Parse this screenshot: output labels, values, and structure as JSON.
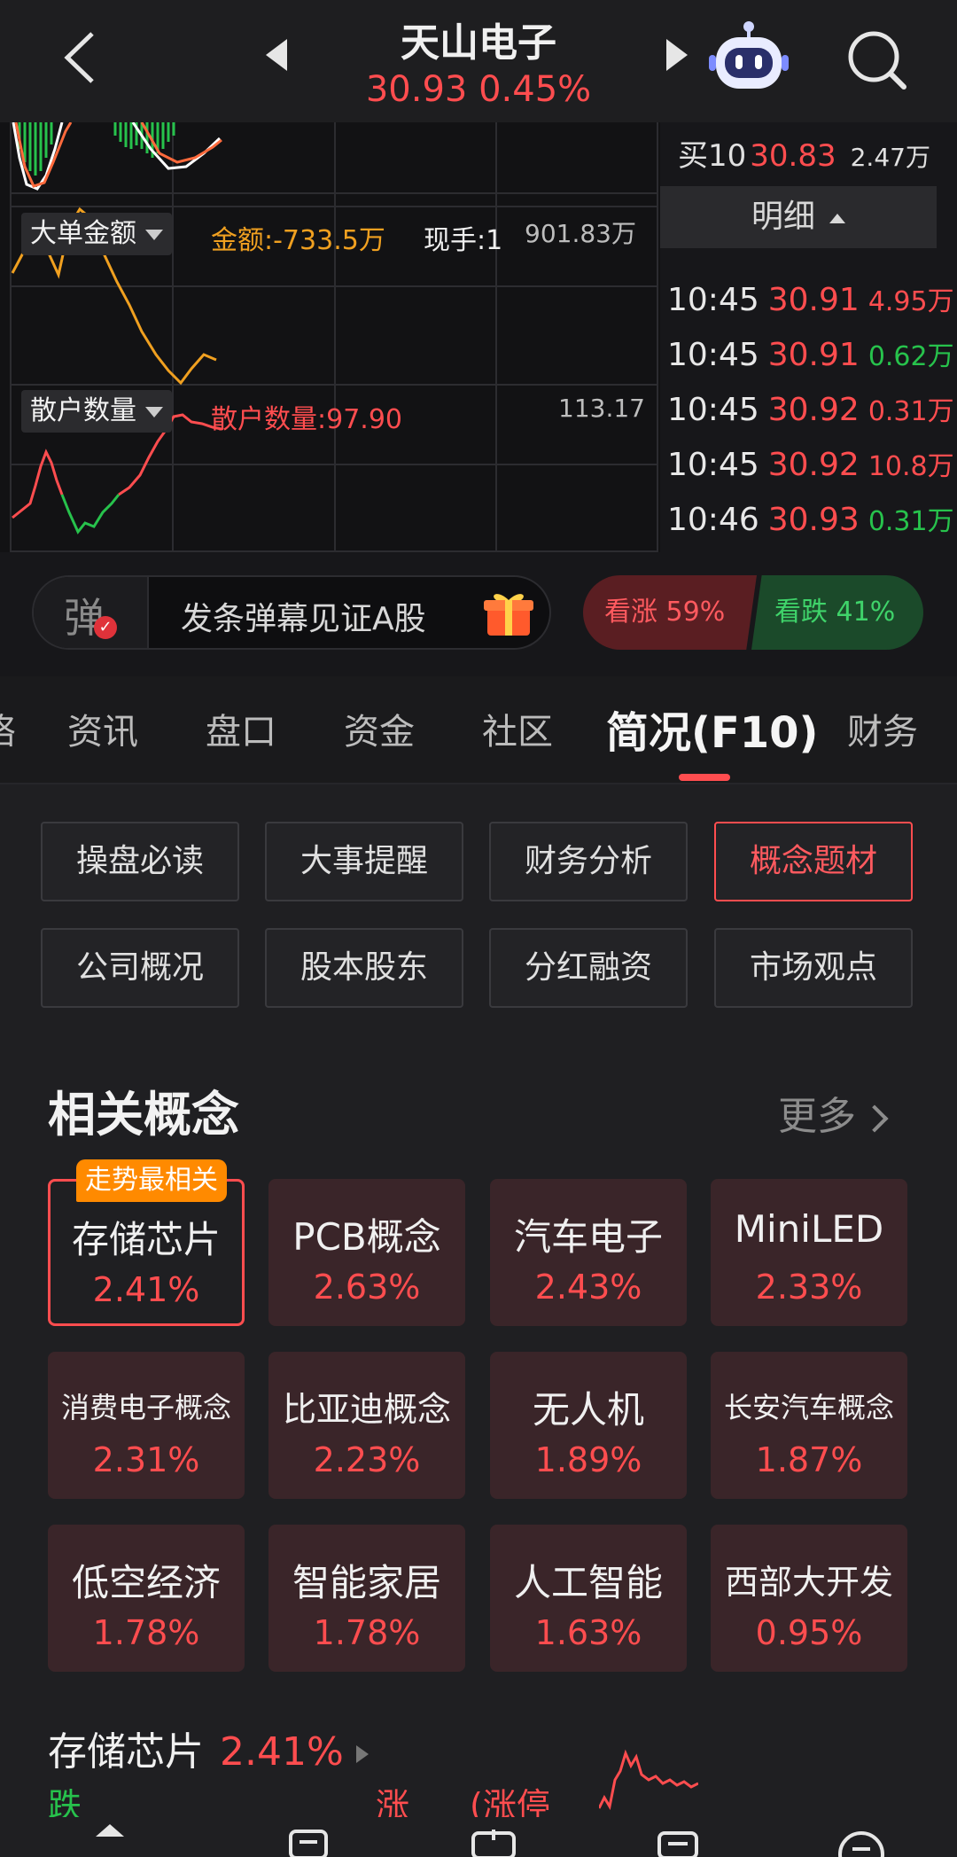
{
  "header": {
    "title": "天山电子",
    "price": "30.93",
    "change_pct": "0.45%"
  },
  "order_book": {
    "buy10_label": "买10",
    "buy10_price": "30.83",
    "buy10_volume": "2.47万"
  },
  "indicators": {
    "big_order": {
      "dropdown_label": "大单金额",
      "value_text": "金额:-733.5万",
      "hand_text": "现手:1",
      "axis_max": "901.83万"
    },
    "retail": {
      "dropdown_label": "散户数量",
      "value_text": "散户数量:97.90",
      "axis_max": "113.17"
    }
  },
  "detail": {
    "header": "明细",
    "ticks": [
      {
        "time": "10:45",
        "price": "30.91",
        "volume": "4.95万",
        "color": "red"
      },
      {
        "time": "10:45",
        "price": "30.91",
        "volume": "0.62万",
        "color": "green"
      },
      {
        "time": "10:45",
        "price": "30.92",
        "volume": "0.31万",
        "color": "red"
      },
      {
        "time": "10:45",
        "price": "30.92",
        "volume": "10.8万",
        "color": "red"
      },
      {
        "time": "10:46",
        "price": "30.93",
        "volume": "0.31万",
        "color": "green"
      }
    ]
  },
  "danmu": {
    "icon_char": "弹",
    "placeholder": "发条弹幕见证A股",
    "vote_up": "看涨 59%",
    "vote_down": "看跌 41%"
  },
  "tabs": [
    {
      "label": "资讯"
    },
    {
      "label": "盘口"
    },
    {
      "label": "资金"
    },
    {
      "label": "社区"
    },
    {
      "label": "简况(F10)"
    },
    {
      "label": "财务"
    }
  ],
  "sub_buttons": [
    {
      "label": "操盘必读"
    },
    {
      "label": "大事提醒"
    },
    {
      "label": "财务分析"
    },
    {
      "label": "概念题材"
    },
    {
      "label": "公司概况"
    },
    {
      "label": "股本股东"
    },
    {
      "label": "分红融资"
    },
    {
      "label": "市场观点"
    }
  ],
  "concepts": {
    "title": "相关概念",
    "more": "更多",
    "badge": "走势最相关",
    "items": [
      {
        "name": "存储芯片",
        "pct": "2.41%"
      },
      {
        "name": "PCB概念",
        "pct": "2.63%"
      },
      {
        "name": "汽车电子",
        "pct": "2.43%"
      },
      {
        "name": "MiniLED",
        "pct": "2.33%"
      },
      {
        "name": "消费电子概念",
        "pct": "2.31%"
      },
      {
        "name": "比亚迪概念",
        "pct": "2.23%"
      },
      {
        "name": "无人机",
        "pct": "1.89%"
      },
      {
        "name": "长安汽车概念",
        "pct": "1.87%"
      },
      {
        "name": "低空经济",
        "pct": "1.78%"
      },
      {
        "name": "智能家居",
        "pct": "1.78%"
      },
      {
        "name": "人工智能",
        "pct": "1.63%"
      },
      {
        "name": "西部大开发",
        "pct": "0.95%"
      }
    ]
  },
  "bottom_concept": {
    "name": "存储芯片",
    "pct": "2.41%",
    "fall": "跌",
    "rise": "涨",
    "limit": "(涨停"
  },
  "colors": {
    "up": "#ff4d4f",
    "down": "#27c24c",
    "accent": "#ff8a00"
  }
}
